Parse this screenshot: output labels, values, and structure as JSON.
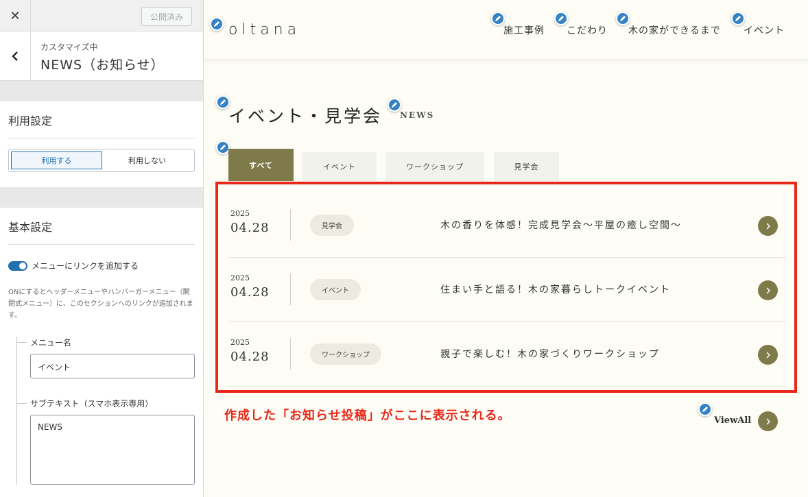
{
  "sidebar": {
    "close_glyph": "✕",
    "publish_label": "公開済み",
    "customizing_label": "カスタマイズ中",
    "section_name": "NEWS（お知らせ）",
    "usage": {
      "title": "利用設定",
      "options": [
        "利用する",
        "利用しない"
      ],
      "selected": "利用する"
    },
    "basic": {
      "title": "基本設定",
      "toggle_label": "メニューにリンクを追加する",
      "description": "ONにするとヘッダーメニューやハンバーガーメニュー（開閉式メニュー）に、このセクションへのリンクが追加されます。",
      "menu_name_label": "メニュー名",
      "menu_name_value": "イベント",
      "subtext_label": "サブテキスト（スマホ表示専用）",
      "subtext_value": "NEWS"
    }
  },
  "site": {
    "logo": "oltana",
    "nav": [
      "施工事例",
      "こだわり",
      "木の家ができるまで",
      "イベント"
    ],
    "section_title": "イベント・見学会",
    "section_en": "NEWS",
    "tabs": [
      "すべて",
      "イベント",
      "ワークショップ",
      "見学会"
    ],
    "active_tab": "すべて",
    "posts": [
      {
        "year": "2025",
        "date": "04.28",
        "category": "見学会",
        "title": "木の香りを体感！完成見学会〜平屋の癒し空間〜"
      },
      {
        "year": "2025",
        "date": "04.28",
        "category": "イベント",
        "title": "住まい手と語る！木の家暮らしトークイベント"
      },
      {
        "year": "2025",
        "date": "04.28",
        "category": "ワークショップ",
        "title": "親子で楽しむ！木の家づくりワークショップ"
      }
    ],
    "note": "作成した「お知らせ投稿」がここに表示される。",
    "view_all": "ViewAll"
  },
  "colors": {
    "accent": "#7e7a4a",
    "highlight": "#e8281b",
    "wp_blue": "#2271b1"
  }
}
